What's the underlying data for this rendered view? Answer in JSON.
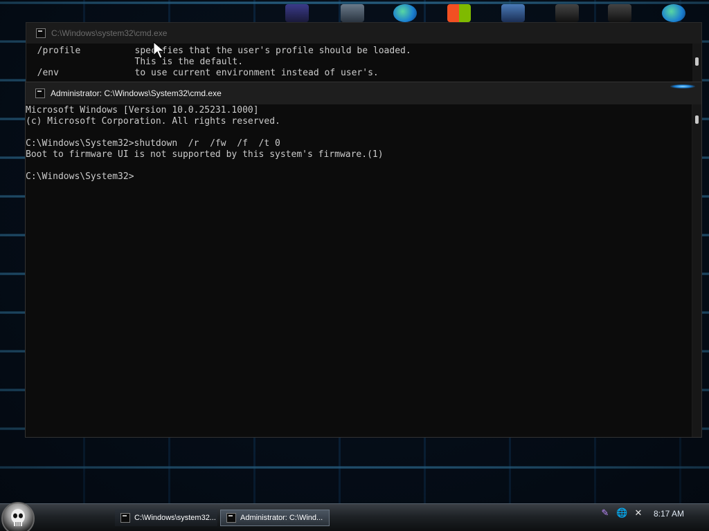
{
  "back_window": {
    "title": "C:\\Windows\\system32\\cmd.exe",
    "lines": [
      "  /profile          specifies that the user's profile should be loaded.",
      "                    This is the default.",
      "  /env              to use current environment instead of user's."
    ]
  },
  "front_window": {
    "title": "Administrator: C:\\Windows\\System32\\cmd.exe",
    "lines": [
      "Microsoft Windows [Version 10.0.25231.1000]",
      "(c) Microsoft Corporation. All rights reserved.",
      "",
      "C:\\Windows\\System32>shutdown  /r  /fw  /f  /t 0",
      "Boot to firmware UI is not supported by this system's firmware.(1)",
      "",
      "C:\\Windows\\System32>"
    ]
  },
  "taskbar": {
    "buttons": [
      {
        "label": "C:\\Windows\\system32..."
      },
      {
        "label": "Administrator: C:\\Wind..."
      }
    ],
    "clock": "8:17 AM",
    "tray_icons": [
      "feather-icon",
      "network-globe-icon",
      "volume-muted-icon"
    ]
  },
  "desktop_icons": [
    "app-icon-1",
    "app-icon-2",
    "edge-icon",
    "store-icon",
    "app-icon-5",
    "app-icon-6",
    "app-icon-7",
    "edge-icon-2"
  ]
}
